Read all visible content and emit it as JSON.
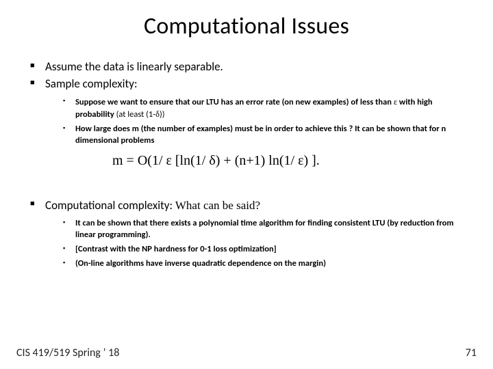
{
  "title": "Computational Issues",
  "bullets1": {
    "b1": "Assume the data is linearly separable.",
    "b2": "Sample complexity:",
    "sub": {
      "s1a": "Suppose we want to ensure that our LTU has an error rate (on new examples) of less than ",
      "s1b": " with high probability ",
      "s1c": "(at least (1-",
      "s1d": "))",
      "s2a": "How large does ",
      "s2b": "m",
      "s2c": " (the number of examples) must be in order to achieve this ? It can be shown that for ",
      "s2d": "n",
      "s2e": " dimensional problems"
    }
  },
  "formula": "m = O(1/ ε [ln(1/ δ) + (n+1) ln(1/ ε) ].",
  "bullets2": {
    "head": "Computational complexity: ",
    "head2": "What can be said?",
    "sub": {
      "t1a": "It can be shown that there exists a polynomial time algorithm for finding ",
      "t1b": "consistent",
      "t1c": " LTU (by reduction from linear programming).",
      "t2": "[Contrast with the NP hardness for 0-1 loss optimization]",
      "t3": "(On-line algorithms have inverse quadratic dependence on the margin)"
    }
  },
  "footer": {
    "left": "CIS 419/519 Spring ’ 18",
    "right": "71"
  },
  "symbols": {
    "eps": "ε",
    "delta": "δ"
  }
}
